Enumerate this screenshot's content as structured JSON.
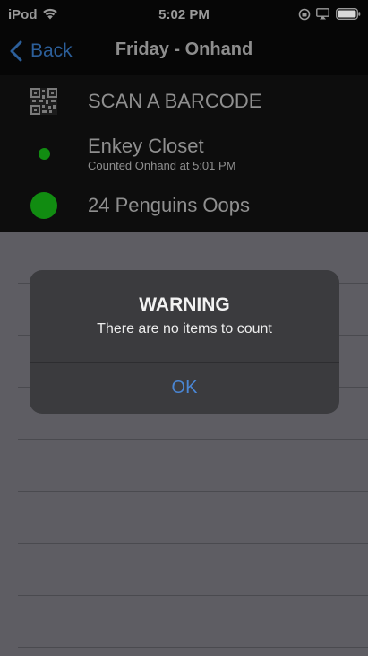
{
  "status_bar": {
    "carrier": "iPod",
    "time": "5:02 PM",
    "icons": [
      "wifi-icon",
      "orientation-lock-icon",
      "airplay-icon",
      "battery-icon"
    ]
  },
  "nav": {
    "back_label": "Back",
    "title": "Friday - Onhand"
  },
  "list": {
    "scan_label": "SCAN A BARCODE",
    "items": [
      {
        "label": "Enkey Closet",
        "subtitle": "Counted Onhand at 5:01 PM",
        "status_color": "#118c11"
      },
      {
        "label": "24 Penguins Oops",
        "subtitle": "",
        "status_color": "#118c11"
      }
    ]
  },
  "alert": {
    "title": "WARNING",
    "message": "There are no items to count",
    "ok_label": "OK"
  },
  "colors": {
    "accent": "#4a86d4",
    "status_green": "#118c11",
    "dim_background": "#5e5d63"
  }
}
